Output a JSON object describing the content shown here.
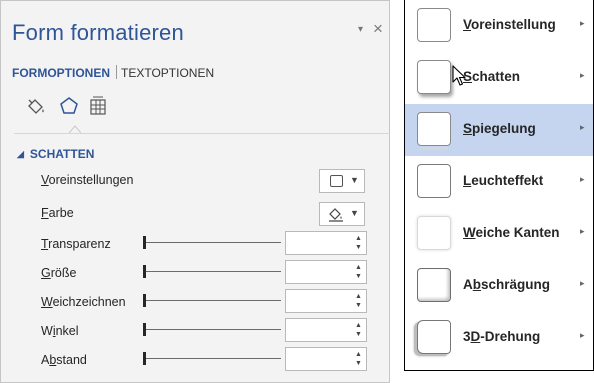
{
  "pane": {
    "title": "Form formatieren",
    "dropdown_glyph": "▾",
    "close_glyph": "×",
    "tabs": [
      {
        "label": "FORMOPTIONEN",
        "active": true
      },
      {
        "label": "TEXTOPTIONEN",
        "active": false
      }
    ],
    "category_icons": [
      "fill-line-icon",
      "effects-icon",
      "size-properties-icon"
    ],
    "active_category": "effects-icon",
    "section": {
      "collapse_glyph": "◢",
      "title": "SCHATTEN",
      "rows": [
        {
          "label_pre": "",
          "label_u": "V",
          "label_post": "oreinstellungen",
          "control": "preset-picker"
        },
        {
          "label_pre": "",
          "label_u": "F",
          "label_post": "arbe",
          "control": "color-picker"
        },
        {
          "label_pre": "",
          "label_u": "T",
          "label_post": "ransparenz",
          "control": "slider",
          "value": ""
        },
        {
          "label_pre": "",
          "label_u": "G",
          "label_post": "röße",
          "control": "slider",
          "value": ""
        },
        {
          "label_pre": "",
          "label_u": "W",
          "label_post": "eichzeichnen",
          "control": "slider",
          "value": ""
        },
        {
          "label_pre": "W",
          "label_u": "i",
          "label_post": "nkel",
          "control": "slider",
          "value": ""
        },
        {
          "label_pre": "A",
          "label_u": "b",
          "label_post": "stand",
          "control": "slider",
          "value": ""
        }
      ]
    },
    "colors": {
      "accent": "#2f5597",
      "pane_bg": "#f3f3f3"
    }
  },
  "menu": {
    "items": [
      {
        "pre": "",
        "u": "V",
        "post": "oreinstellung",
        "thumb": "preset",
        "highlighted": false
      },
      {
        "pre": "",
        "u": "S",
        "post": "chatten",
        "thumb": "shadow",
        "highlighted": false
      },
      {
        "pre": "",
        "u": "S",
        "post": "piegelung",
        "thumb": "reflect",
        "highlighted": true
      },
      {
        "pre": "",
        "u": "L",
        "post": "euchteffekt",
        "thumb": "glow",
        "highlighted": false
      },
      {
        "pre": "",
        "u": "W",
        "post": "eiche Kanten",
        "thumb": "soft",
        "highlighted": false
      },
      {
        "pre": "A",
        "u": "b",
        "post": "schrägung",
        "thumb": "bevel",
        "highlighted": false
      },
      {
        "pre": "3",
        "u": "D",
        "post": "-Drehung",
        "thumb": "rot3d",
        "highlighted": false
      }
    ],
    "caret_glyph": "▸",
    "colors": {
      "highlight": "#c5d5f0"
    }
  }
}
